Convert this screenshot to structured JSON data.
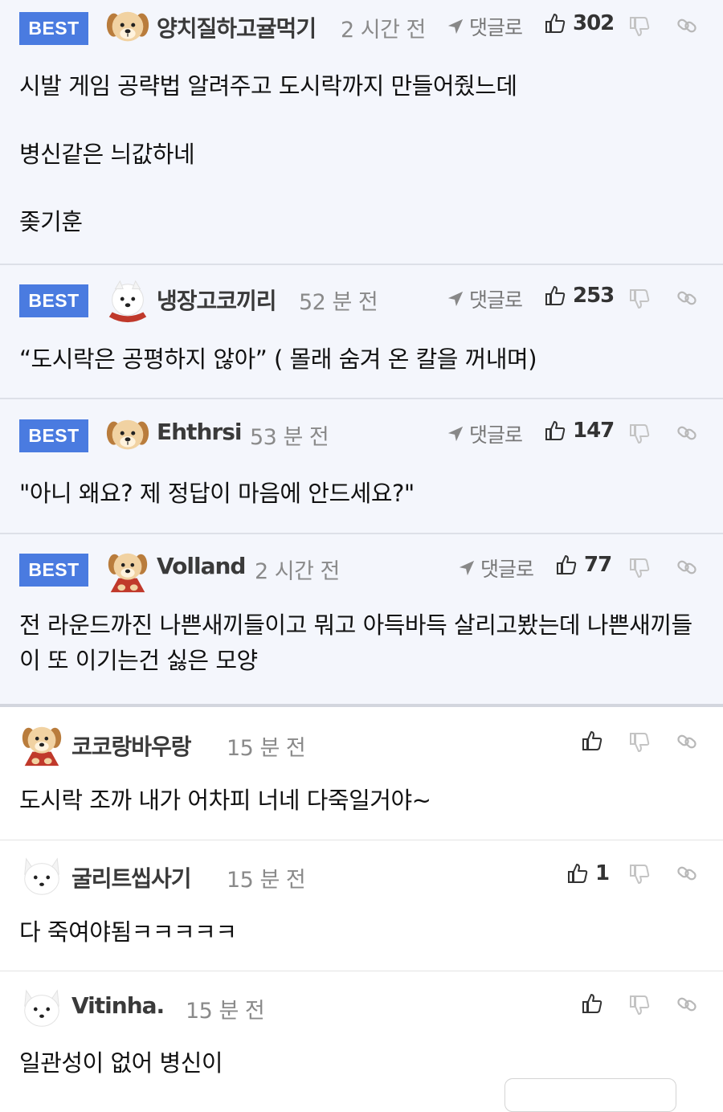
{
  "best_label": "BEST",
  "reply_label": "댓글로",
  "comments": [
    {
      "nickname": "양치질하고귤먹기",
      "time": "2 시간 전",
      "likes": "302",
      "avatar": "puppy-avatar",
      "paragraphs": [
        "시발 게임 공략법 알려주고 도시락까지 만들어줬느데",
        "병신같은 늬값하네",
        "좆기훈"
      ]
    },
    {
      "nickname": "냉장고코끼리",
      "time": "52 분 전",
      "likes": "253",
      "avatar": "white-dog-avatar",
      "paragraphs": [
        "“도시락은 공평하지 않아” ( 몰래 숨겨 온 칼을 꺼내며)"
      ]
    },
    {
      "nickname": "Ehthrsi",
      "time": "53 분 전",
      "likes": "147",
      "avatar": "puppy-avatar",
      "paragraphs": [
        "\"아니 왜요? 제 정답이 마음에 안드세요?\""
      ]
    },
    {
      "nickname": "Volland",
      "time": "2 시간 전",
      "likes": "77",
      "avatar": "puppy-cape-avatar",
      "paragraphs": [
        "전 라운드까진 나쁜새끼들이고 뭐고 아득바득 살리고봤는데 나쁜새끼들이 또 이기는건 싫은 모양"
      ]
    },
    {
      "nickname": "코코랑바우랑",
      "time": "15 분 전",
      "likes": "",
      "avatar": "puppy-cape-avatar",
      "paragraphs": [
        "도시락 조까 내가 어차피 너네 다죽일거야~"
      ]
    },
    {
      "nickname": "굴리트씹사기",
      "time": "15 분 전",
      "likes": "1",
      "avatar": "arctic-fox-avatar",
      "paragraphs": [
        "다 죽여야됨ㅋㅋㅋㅋㅋ"
      ]
    },
    {
      "nickname": "Vitinha.",
      "time": "15 분 전",
      "likes": "",
      "avatar": "arctic-fox-avatar",
      "paragraphs": [
        "일관성이 없어 병신이"
      ]
    }
  ],
  "colors": {
    "best_badge": "#4a7be0",
    "best_background": "#f4f6fc",
    "time_text": "#8a8a8a"
  }
}
